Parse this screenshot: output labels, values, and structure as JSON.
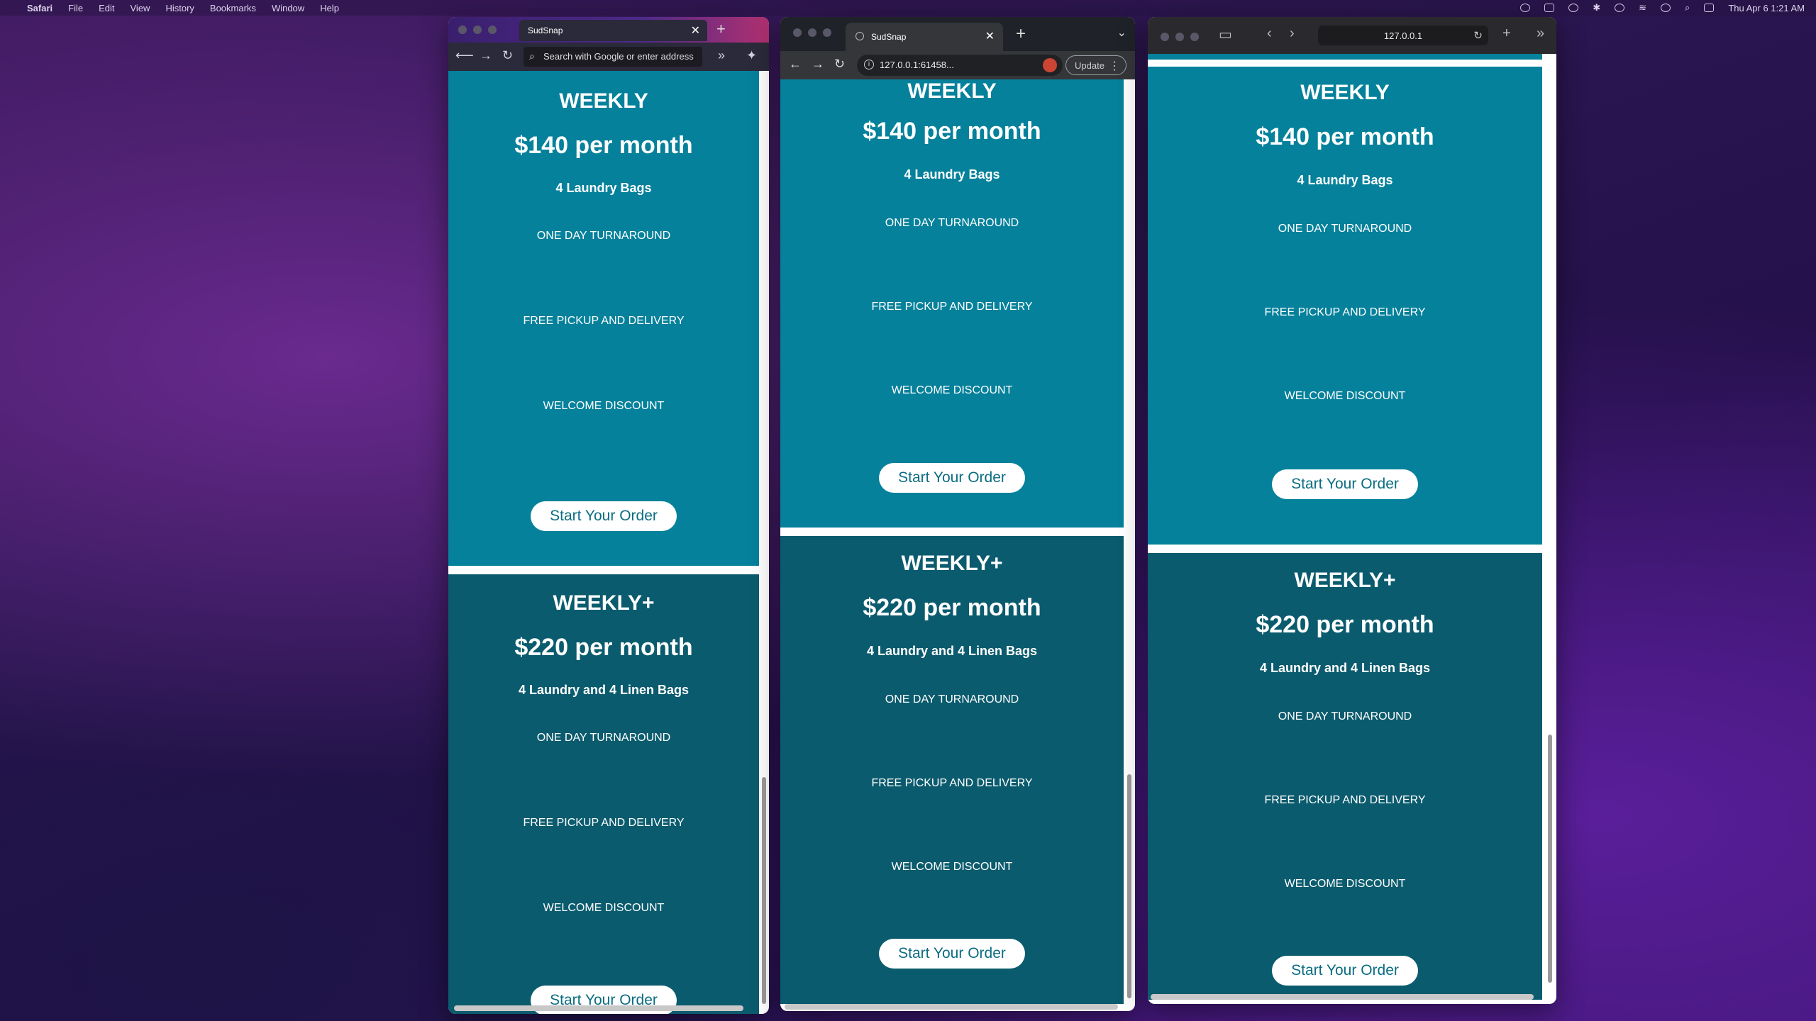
{
  "menubar": {
    "app": "Safari",
    "items": [
      "File",
      "Edit",
      "View",
      "History",
      "Bookmarks",
      "Window",
      "Help"
    ],
    "clock": "Thu Apr 6  1:21 AM"
  },
  "firefox": {
    "tab_title": "SudSnap",
    "url_placeholder": "Search with Google or enter address"
  },
  "chrome": {
    "tab_title": "SudSnap",
    "url": "127.0.0.1:61458...",
    "update_label": "Update"
  },
  "safari": {
    "url": "127.0.0.1"
  },
  "plans": {
    "weekly": {
      "name": "WEEKLY",
      "price": "$140 per month",
      "bags": "4 Laundry Bags",
      "features": [
        "ONE DAY TURNAROUND",
        "FREE PICKUP AND DELIVERY",
        "WELCOME DISCOUNT"
      ],
      "cta": "Start Your Order"
    },
    "weeklyplus": {
      "name": "WEEKLY+",
      "price": "$220 per month",
      "bags": "4 Laundry and 4 Linen Bags",
      "features": [
        "ONE DAY TURNAROUND",
        "FREE PICKUP AND DELIVERY",
        "WELCOME DISCOUNT"
      ],
      "cta": "Start Your Order"
    }
  },
  "colors": {
    "weekly_bg": "#05819b",
    "weeklyplus_bg": "#0b5b6e",
    "button_text": "#0b6d82"
  }
}
